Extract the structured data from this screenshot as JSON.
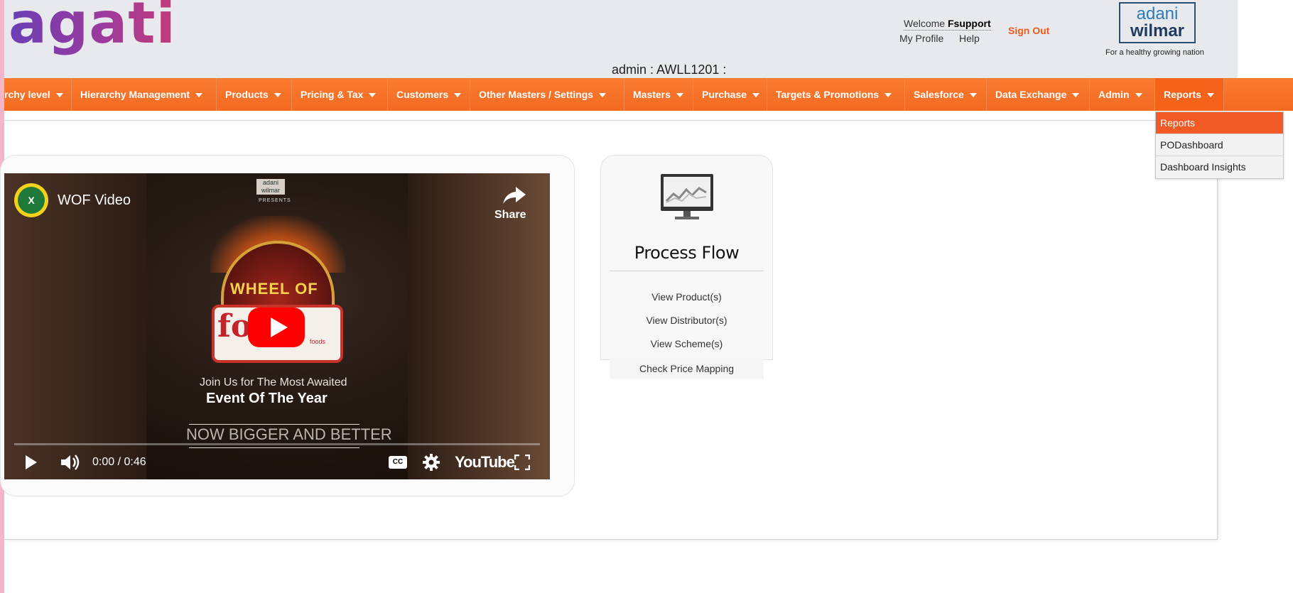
{
  "header": {
    "logo_text": "agati",
    "welcome_prefix": "Welcome",
    "username": "Fsupport",
    "my_profile": "My Profile",
    "help": "Help",
    "sign_out": "Sign Out",
    "brand_line1": "adani",
    "brand_line2": "wilmar",
    "tagline": "For a healthy growing nation",
    "admin_line": "admin : AWLL1201 :"
  },
  "nav": {
    "items": [
      {
        "label": "rchy level"
      },
      {
        "label": "Hierarchy Management"
      },
      {
        "label": "Products"
      },
      {
        "label": "Pricing & Tax"
      },
      {
        "label": "Customers"
      },
      {
        "label": "Other Masters / Settings"
      },
      {
        "label": "Masters"
      },
      {
        "label": "Purchase"
      },
      {
        "label": "Targets & Promotions"
      },
      {
        "label": "Salesforce"
      },
      {
        "label": "Data Exchange"
      },
      {
        "label": "Admin"
      },
      {
        "label": "Reports"
      }
    ],
    "accent": "#f36a22"
  },
  "dropdown": {
    "items": [
      {
        "label": "Reports",
        "selected": true
      },
      {
        "label": "PODashboard",
        "selected": false
      },
      {
        "label": "Dashboard Insights",
        "selected": false
      }
    ]
  },
  "video": {
    "channel_initial": "X",
    "title": "WOF Video",
    "share_label": "Share",
    "brand_mini": "adani wilmar",
    "presents": "PRESENTS",
    "wheel_text": "WHEEL OF",
    "fortune_text": "fo    e",
    "foods_text": "foods",
    "join_text": "Join Us for The Most Awaited",
    "event_text": "Event Of The Year",
    "bigger_text": "NOW BIGGER AND BETTER",
    "time": "0:00 / 0:46",
    "cc": "CC",
    "youtube_label": "YouTube",
    "progress": 0
  },
  "process_flow": {
    "title": "Process Flow",
    "links": [
      "View Product(s)",
      "View Distributor(s)",
      "View Scheme(s)",
      "Check Price Mapping"
    ]
  }
}
